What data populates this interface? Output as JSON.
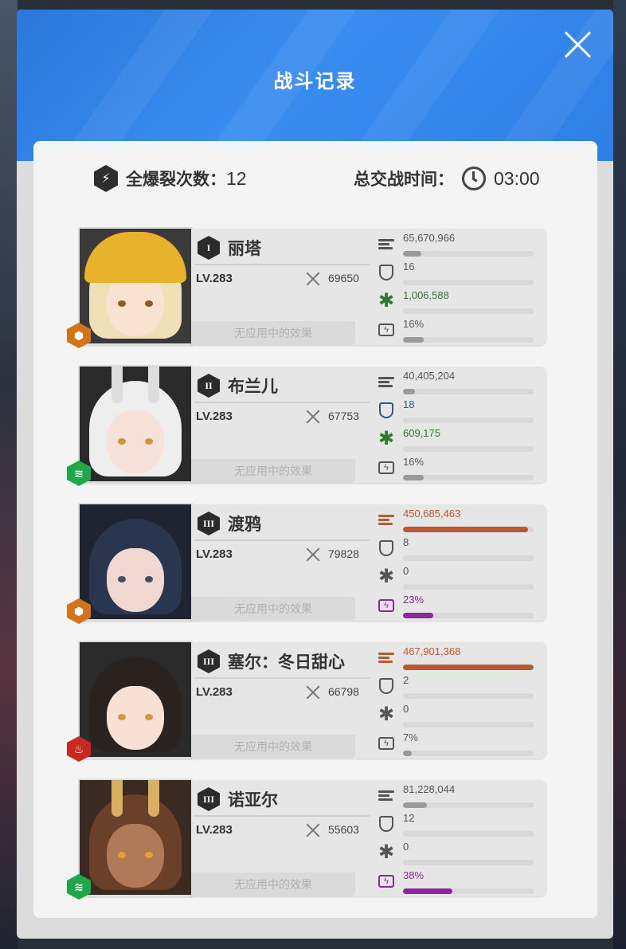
{
  "modal": {
    "title": "战斗记录"
  },
  "summary": {
    "burst_label": "全爆裂次数：",
    "burst_count": "12",
    "time_label": "总交战时间：",
    "time_value": "03:00"
  },
  "colors": {
    "header_blue": "#2f82e8",
    "damage_orange": "#b85a30",
    "heal_green": "#2d7a2d",
    "shield_blue": "#2a5a8a",
    "burst_purple": "#8a2a9a"
  },
  "characters": [
    {
      "rank": "I",
      "name": "丽塔",
      "level": "LV.283",
      "power": "69650",
      "effect": "无应用中的效果",
      "element": "electric",
      "damage": "65,670,966",
      "damage_frac": 0.14,
      "shield": "16",
      "shield_frac": 0,
      "heal": "1,006,588",
      "heal_frac": 0,
      "burst": "16%",
      "burst_frac": 0.16,
      "highlight": "heal"
    },
    {
      "rank": "II",
      "name": "布兰儿",
      "level": "LV.283",
      "power": "67753",
      "effect": "无应用中的效果",
      "element": "wind",
      "damage": "40,405,204",
      "damage_frac": 0.09,
      "shield": "18",
      "shield_frac": 0,
      "heal": "609,175",
      "heal_frac": 0,
      "burst": "16%",
      "burst_frac": 0.16,
      "highlight": "shield"
    },
    {
      "rank": "III",
      "name": "渡鸦",
      "level": "LV.283",
      "power": "79828",
      "effect": "无应用中的效果",
      "element": "electric",
      "damage": "450,685,463",
      "damage_frac": 0.96,
      "shield": "8",
      "shield_frac": 0,
      "heal": "0",
      "heal_frac": 0,
      "burst": "23%",
      "burst_frac": 0.23,
      "highlight": "damage"
    },
    {
      "rank": "III",
      "name": "塞尔：冬日甜心",
      "level": "LV.283",
      "power": "66798",
      "effect": "无应用中的效果",
      "element": "fire",
      "damage": "467,901,368",
      "damage_frac": 1.0,
      "shield": "2",
      "shield_frac": 0,
      "heal": "0",
      "heal_frac": 0,
      "burst": "7%",
      "burst_frac": 0.07,
      "highlight": "damage"
    },
    {
      "rank": "III",
      "name": "诺亚尔",
      "level": "LV.283",
      "power": "55603",
      "effect": "无应用中的效果",
      "element": "wind",
      "damage": "81,228,044",
      "damage_frac": 0.18,
      "shield": "12",
      "shield_frac": 0,
      "heal": "0",
      "heal_frac": 0,
      "burst": "38%",
      "burst_frac": 0.38,
      "highlight": "burst"
    }
  ]
}
